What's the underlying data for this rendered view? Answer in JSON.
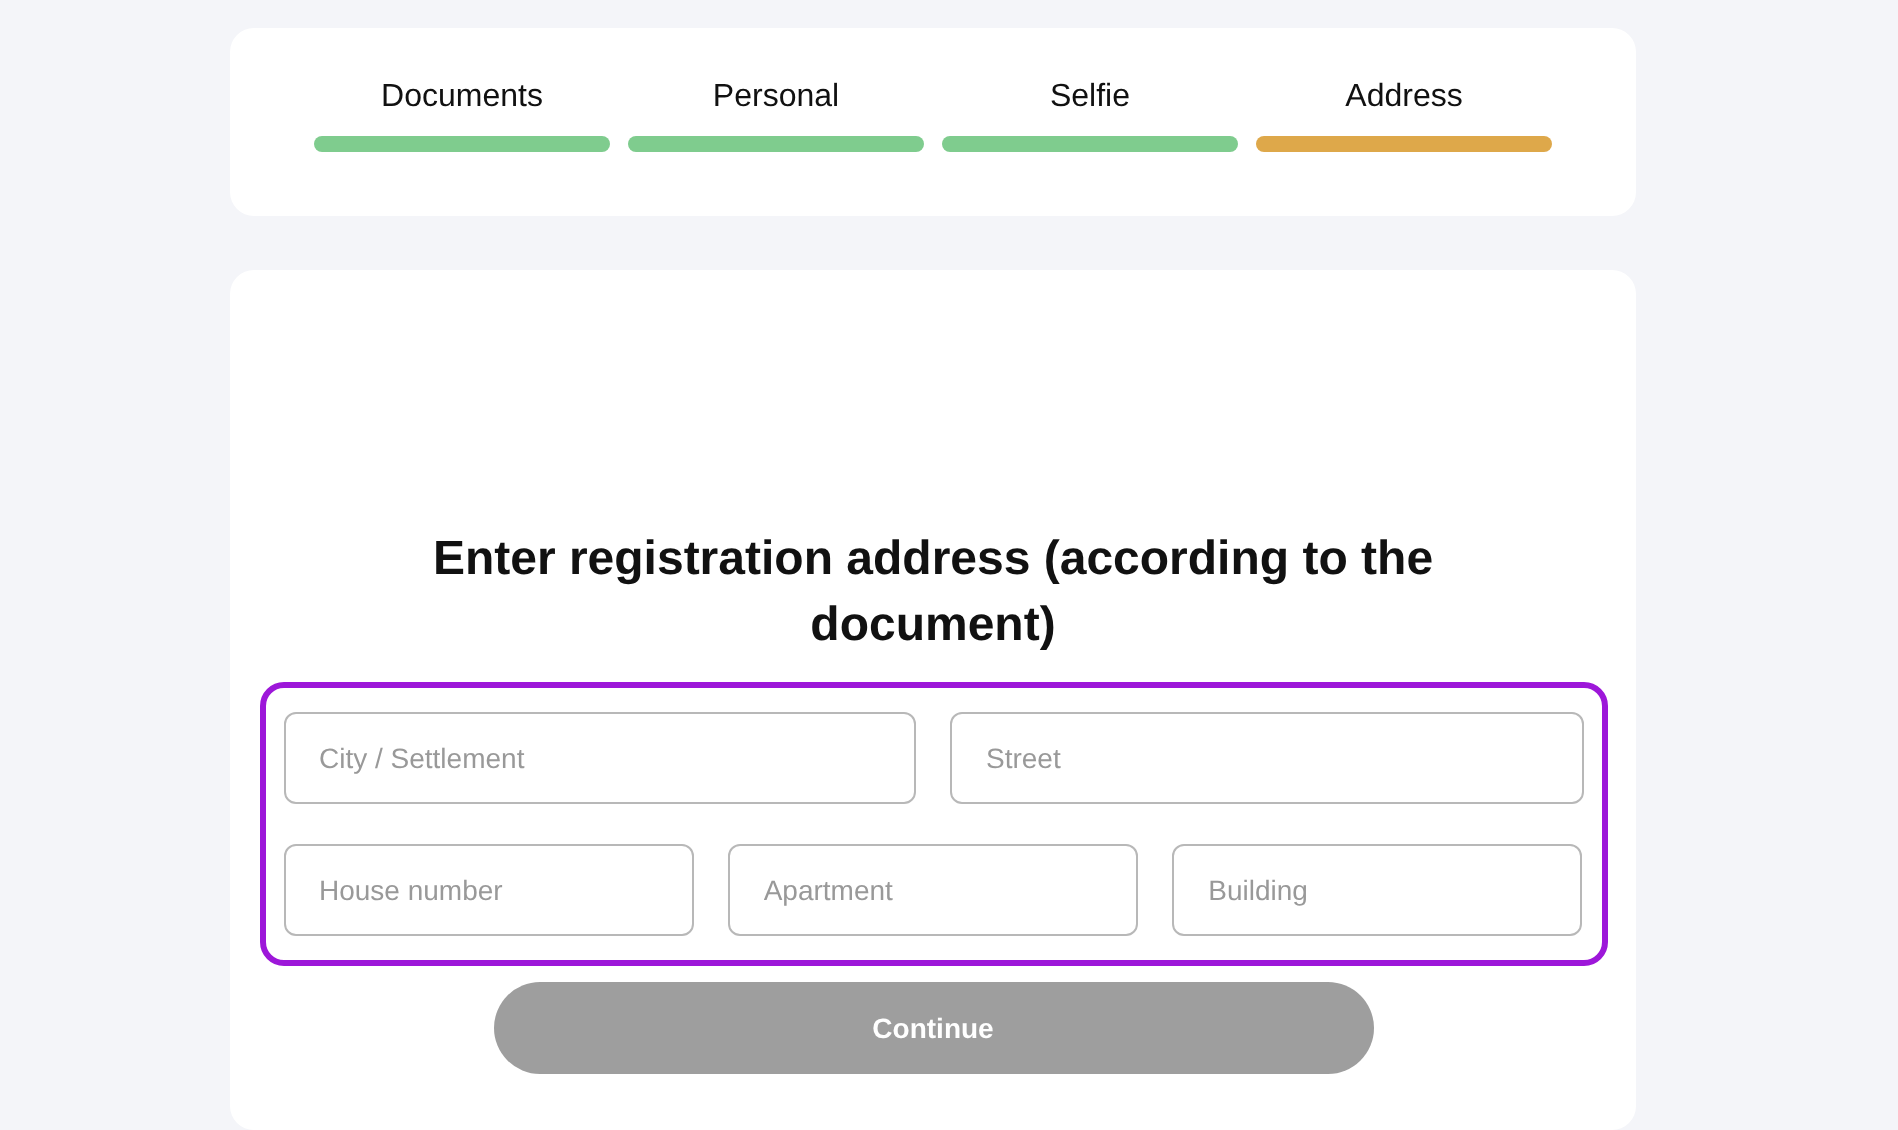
{
  "steps": [
    {
      "label": "Documents",
      "color": "#7fcc8e"
    },
    {
      "label": "Personal",
      "color": "#7fcc8e"
    },
    {
      "label": "Selfie",
      "color": "#7fcc8e"
    },
    {
      "label": "Address",
      "color": "#dea84a"
    }
  ],
  "heading": "Enter registration address (according to the document)",
  "fields_row_1": [
    {
      "placeholder": "City / Settlement"
    },
    {
      "placeholder": "Street"
    }
  ],
  "fields_row_2": [
    {
      "placeholder": "House number"
    },
    {
      "placeholder": "Apartment"
    },
    {
      "placeholder": "Building"
    }
  ],
  "continue_button": {
    "label": "Continue",
    "disabled": true
  }
}
